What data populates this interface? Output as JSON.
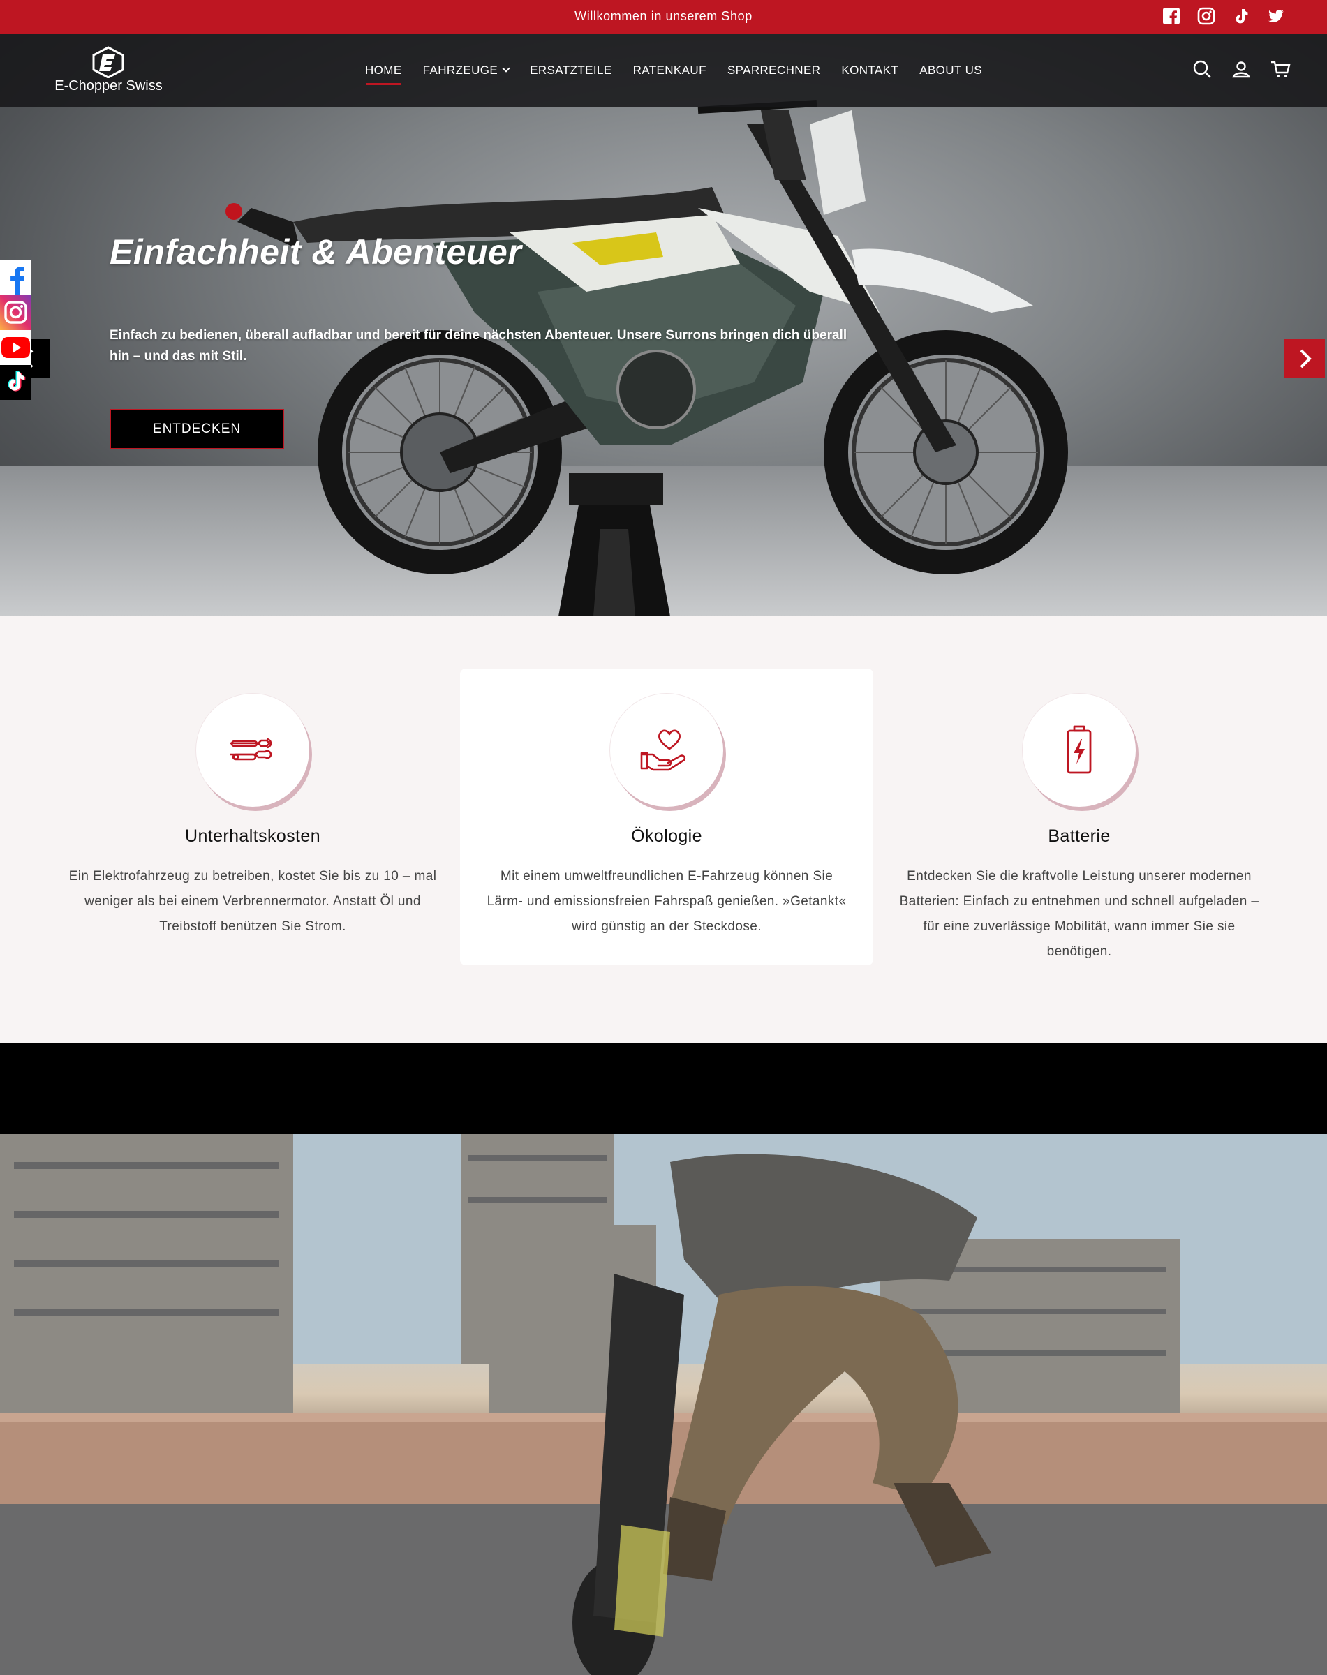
{
  "announcement": {
    "text": "Willkommen in unserem Shop",
    "social": [
      "facebook-icon",
      "instagram-icon",
      "tiktok-icon",
      "twitter-icon"
    ]
  },
  "header": {
    "logo_text": "E-Chopper Swiss",
    "nav": [
      {
        "label": "HOME",
        "active": true
      },
      {
        "label": "FAHRZEUGE",
        "dropdown": true
      },
      {
        "label": "ERSATZTEILE"
      },
      {
        "label": "RATENKAUF"
      },
      {
        "label": "SPARRECHNER"
      },
      {
        "label": "KONTAKT"
      },
      {
        "label": "ABOUT US"
      }
    ],
    "icons": [
      "search-icon",
      "account-icon",
      "cart-icon"
    ]
  },
  "hero": {
    "title": "Einfachheit & Abenteuer",
    "subtitle": "Einfach zu bedienen, überall aufladbar und bereit für deine nächsten Abenteuer. Unsere Surrons bringen dich überall hin – und das mit Stil.",
    "button": "ENTDECKEN"
  },
  "floating_social": [
    "facebook-icon",
    "instagram-icon",
    "youtube-icon",
    "tiktok-icon"
  ],
  "features": [
    {
      "icon": "wrench-icon",
      "title": "Unterhaltskosten",
      "text": "Ein Elektrofahrzeug zu betreiben, kostet Sie bis zu 10 – mal weniger als bei einem Verbrennermotor. Anstatt Öl und Treibstoff benützen Sie Strom."
    },
    {
      "icon": "heart-hand-icon",
      "title": "Ökologie",
      "text": "Mit einem umweltfreundlichen E-Fahrzeug können Sie Lärm- und emissionsfreien Fahrspaß genießen. »Getankt« wird günstig an der Steckdose."
    },
    {
      "icon": "battery-icon",
      "title": "Batterie",
      "text": "Entdecken Sie die kraftvolle Leistung unserer modernen Batterien: Einfach zu entnehmen und schnell aufgeladen – für eine zuverlässige Mobilität, wann immer Sie sie benötigen."
    }
  ],
  "colors": {
    "brand_red": "#be1622",
    "header_bg": "#1c1c1e",
    "features_bg": "#f8f4f4"
  }
}
